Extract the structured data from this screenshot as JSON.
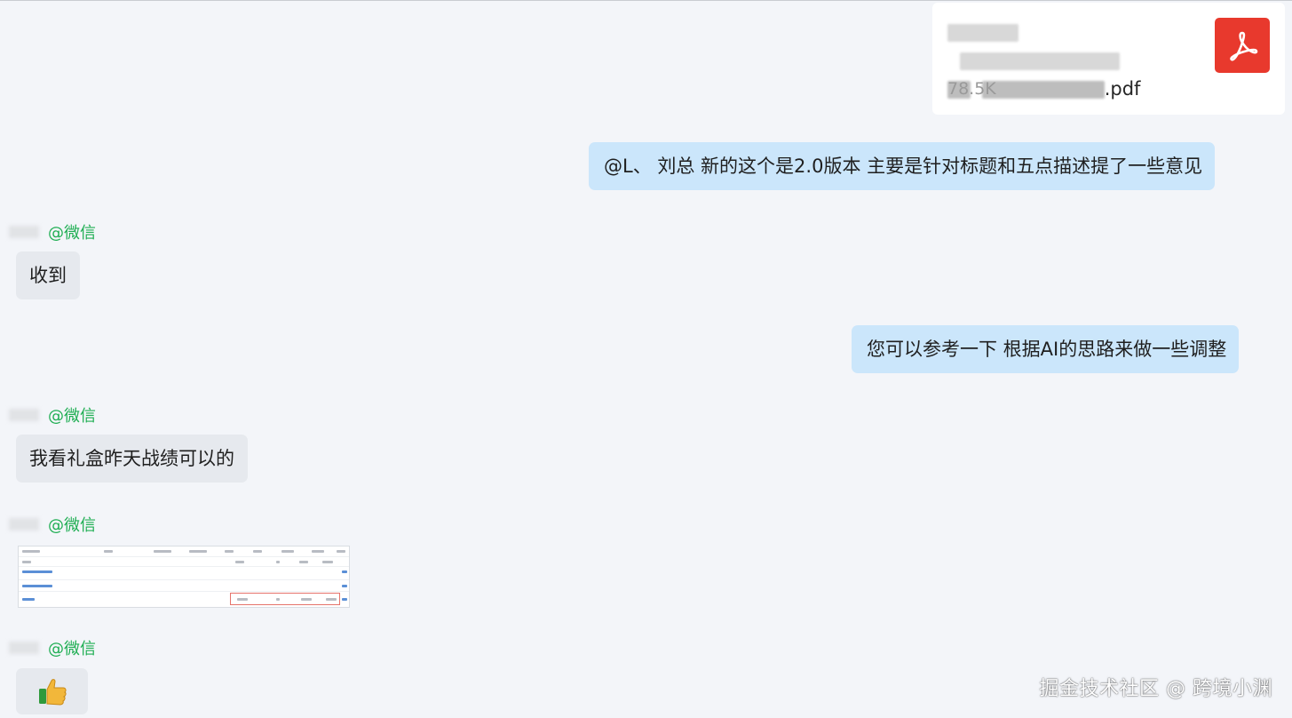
{
  "pdf_message": {
    "filename_suffix": ".pdf",
    "file_size": "78.5K",
    "icon": "pdf-icon",
    "icon_color": "#e8392d"
  },
  "messages": {
    "out_1": "@L、 刘总  新的这个是2.0版本 主要是针对标题和五点描述提了一些意见",
    "in_1": "收到",
    "out_2": "您可以参考一下  根据AI的思路来做一些调整",
    "in_2": "我看礼盒昨天战绩可以的",
    "in_4_emoji": "👍"
  },
  "senders": {
    "tag": "@微信"
  },
  "colors": {
    "outgoing_bubble": "#cbe6fb",
    "incoming_bubble": "#e6e9ee",
    "sender_tag": "#1fae53",
    "background": "#f3f5f9"
  },
  "watermark": "掘金技术社区 @ 跨境小渊"
}
